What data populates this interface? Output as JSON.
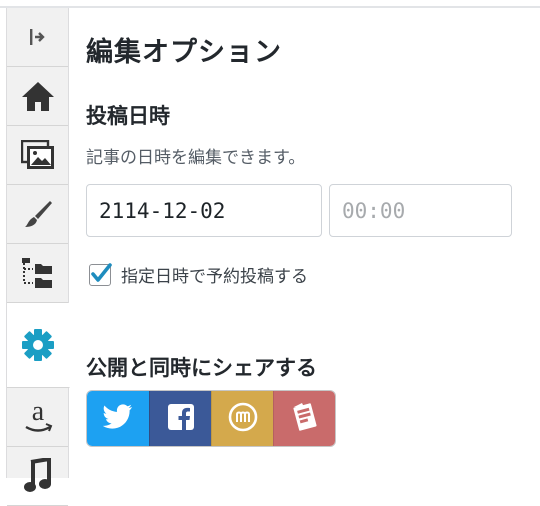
{
  "panel": {
    "title": "編集オプション",
    "schedule": {
      "heading": "投稿日時",
      "description": "記事の日時を編集できます。",
      "date_value": "2114-12-02",
      "time_placeholder": "00:00",
      "checkbox_label": "指定日時で予約投稿する",
      "checkbox_checked": true
    },
    "share": {
      "heading": "公開と同時にシェアする",
      "buttons": [
        {
          "icon": "twitter-icon",
          "color": "#1da1f2"
        },
        {
          "icon": "facebook-icon",
          "color": "#3b5998"
        },
        {
          "icon": "mixi-icon",
          "color": "#d4a94c"
        },
        {
          "icon": "hatena-icon",
          "color": "#c96b6b"
        }
      ]
    }
  },
  "sidebar": {
    "tabs": [
      {
        "icon": "collapse-arrow-icon"
      },
      {
        "icon": "home-icon"
      },
      {
        "icon": "image-icon"
      },
      {
        "icon": "brush-icon"
      },
      {
        "icon": "folder-tree-icon"
      },
      {
        "icon": "gear-icon",
        "active": true
      },
      {
        "icon": "amazon-icon"
      },
      {
        "icon": "music-icon"
      }
    ],
    "active_color": "#1b9ec4"
  }
}
